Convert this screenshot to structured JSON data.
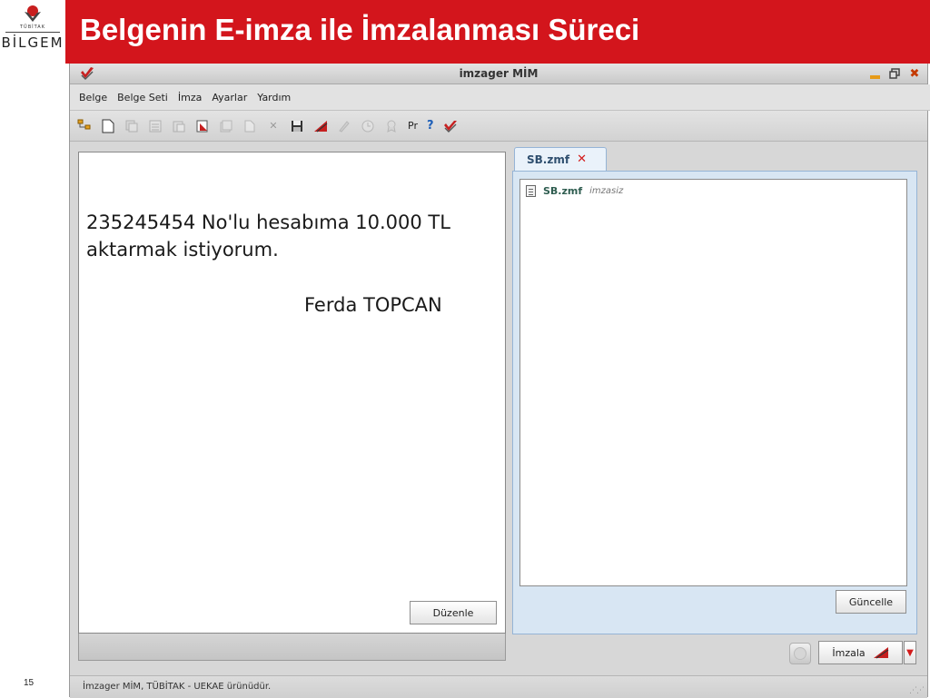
{
  "slide": {
    "title": "Belgenin E-imza ile İmzalanması Süreci",
    "page_number": "15",
    "logo_small": "TÜBİTAK",
    "logo_name": "BİLGEM"
  },
  "window": {
    "title": "imzager MİM"
  },
  "menu": {
    "items": [
      "Belge",
      "Belge Seti",
      "İmza",
      "Ayarlar",
      "Yardım"
    ]
  },
  "toolbar": {
    "pr_label": "Pr",
    "help_label": "?"
  },
  "document": {
    "body": "235245454 No'lu hesabıma 10.000 TL aktarmak istiyorum.",
    "signature": "Ferda TOPCAN",
    "edit_label": "Düzenle"
  },
  "tab": {
    "label": "SB.zmf",
    "close_glyph": "✕"
  },
  "file_list": {
    "items": [
      {
        "name": "SB.zmf",
        "status": "imzasiz"
      }
    ],
    "refresh_label": "Güncelle"
  },
  "sign": {
    "label": "İmzala"
  },
  "status_bar": {
    "text": "İmzager MİM, TÜBİTAK - UEKAE ürünüdür."
  },
  "colors": {
    "title_bar": "#d3151c",
    "accent_red": "#c62020",
    "tab_border": "#95b4d6"
  }
}
